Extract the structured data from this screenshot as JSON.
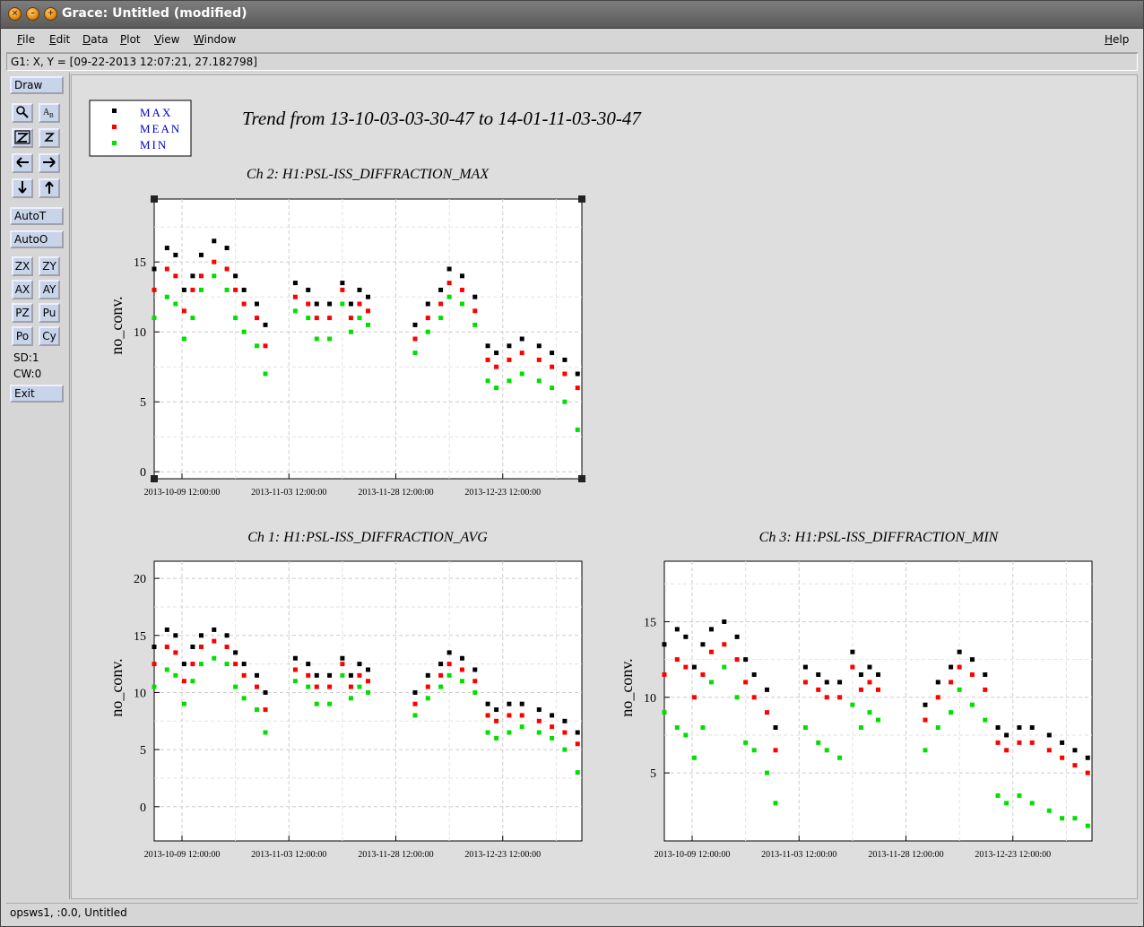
{
  "window": {
    "title": "Grace: Untitled (modified)"
  },
  "menubar": {
    "items": [
      "File",
      "Edit",
      "Data",
      "Plot",
      "View",
      "Window"
    ],
    "accel": [
      "F",
      "E",
      "D",
      "P",
      "V",
      "W"
    ],
    "help": "Help",
    "help_accel": "H"
  },
  "coordbar": {
    "text": "G1: X, Y = [09-22-2013 12:07:21, 27.182798]"
  },
  "toolbar": {
    "draw": "Draw",
    "autot": "AutoT",
    "autoo": "AutoO",
    "pairs": [
      [
        "ZX",
        "ZY"
      ],
      [
        "AX",
        "AY"
      ],
      [
        "PZ",
        "Pu"
      ],
      [
        "Po",
        "Cy"
      ]
    ],
    "sd": "SD:1",
    "cw": "CW:0",
    "exit": "Exit",
    "icons": [
      "zoom-icon",
      "autoscale-icon",
      "zoom-in-icon",
      "zoom-out-icon",
      "arrow-left-icon",
      "arrow-right-icon",
      "arrow-down-icon",
      "arrow-up-icon"
    ]
  },
  "statusbar": {
    "text": "opsws1, :0.0, Untitled"
  },
  "figure": {
    "title": "Trend from 13-10-03-03-30-47 to 14-01-11-03-30-47",
    "legend": [
      {
        "label": "MAX",
        "color": "#000000"
      },
      {
        "label": "MEAN",
        "color": "#ff0000"
      },
      {
        "label": "MIN",
        "color": "#00e000"
      }
    ]
  },
  "chart_data": [
    {
      "type": "scatter",
      "title": "Ch 2: H1:PSL-ISS_DIFFRACTION_MAX",
      "ylabel": "no_conv.",
      "ylim": [
        -0.5,
        19.5
      ],
      "yticks": [
        0,
        5,
        10,
        15
      ],
      "xlim": [
        "2013-10-03",
        "2014-01-11"
      ],
      "xticks": [
        "2013-10-09 12:00:00",
        "2013-11-03 12:00:00",
        "2013-11-28 12:00:00",
        "2013-12-23 12:00:00"
      ],
      "series": [
        {
          "name": "MAX",
          "color": "#000000",
          "x": [
            "2013-10-03",
            "2013-10-06",
            "2013-10-08",
            "2013-10-10",
            "2013-10-12",
            "2013-10-14",
            "2013-10-17",
            "2013-10-20",
            "2013-10-22",
            "2013-10-24",
            "2013-10-27",
            "2013-10-29",
            "2013-11-05",
            "2013-11-08",
            "2013-11-10",
            "2013-11-13",
            "2013-11-16",
            "2013-11-18",
            "2013-11-20",
            "2013-11-22",
            "2013-12-03",
            "2013-12-06",
            "2013-12-09",
            "2013-12-11",
            "2013-12-14",
            "2013-12-17",
            "2013-12-20",
            "2013-12-22",
            "2013-12-25",
            "2013-12-28",
            "2014-01-01",
            "2014-01-04",
            "2014-01-07",
            "2014-01-10"
          ],
          "y": [
            14.5,
            16,
            15.5,
            13,
            14,
            15.5,
            16.5,
            16,
            14,
            13,
            12,
            10.5,
            13.5,
            13,
            12,
            12,
            13.5,
            12,
            13,
            12.5,
            10.5,
            12,
            13,
            14.5,
            14,
            12.5,
            9,
            8.5,
            9,
            9.5,
            9,
            8.5,
            8,
            7
          ]
        },
        {
          "name": "MEAN",
          "color": "#ff0000",
          "x": [
            "2013-10-03",
            "2013-10-06",
            "2013-10-08",
            "2013-10-10",
            "2013-10-12",
            "2013-10-14",
            "2013-10-17",
            "2013-10-20",
            "2013-10-22",
            "2013-10-24",
            "2013-10-27",
            "2013-10-29",
            "2013-11-05",
            "2013-11-08",
            "2013-11-10",
            "2013-11-13",
            "2013-11-16",
            "2013-11-18",
            "2013-11-20",
            "2013-11-22",
            "2013-12-03",
            "2013-12-06",
            "2013-12-09",
            "2013-12-11",
            "2013-12-14",
            "2013-12-17",
            "2013-12-20",
            "2013-12-22",
            "2013-12-25",
            "2013-12-28",
            "2014-01-01",
            "2014-01-04",
            "2014-01-07",
            "2014-01-10"
          ],
          "y": [
            13,
            14.5,
            14,
            11.5,
            13,
            14,
            15,
            14.5,
            13,
            12,
            11,
            9,
            12.5,
            12,
            11,
            11,
            13,
            11,
            12,
            11.5,
            9.5,
            11,
            12,
            13.5,
            13,
            11.5,
            8,
            7.5,
            8,
            8.5,
            8,
            7.5,
            7,
            6
          ]
        },
        {
          "name": "MIN",
          "color": "#00e000",
          "x": [
            "2013-10-03",
            "2013-10-06",
            "2013-10-08",
            "2013-10-10",
            "2013-10-12",
            "2013-10-14",
            "2013-10-17",
            "2013-10-20",
            "2013-10-22",
            "2013-10-24",
            "2013-10-27",
            "2013-10-29",
            "2013-11-05",
            "2013-11-08",
            "2013-11-10",
            "2013-11-13",
            "2013-11-16",
            "2013-11-18",
            "2013-11-20",
            "2013-11-22",
            "2013-12-03",
            "2013-12-06",
            "2013-12-09",
            "2013-12-11",
            "2013-12-14",
            "2013-12-17",
            "2013-12-20",
            "2013-12-22",
            "2013-12-25",
            "2013-12-28",
            "2014-01-01",
            "2014-01-04",
            "2014-01-07",
            "2014-01-10"
          ],
          "y": [
            11,
            12.5,
            12,
            9.5,
            11,
            13,
            14,
            13,
            11,
            10,
            9,
            7,
            11.5,
            11,
            9.5,
            9.5,
            12,
            10,
            11,
            10.5,
            8.5,
            10,
            11,
            12.5,
            12,
            10.5,
            6.5,
            6,
            6.5,
            7,
            6.5,
            6,
            5,
            3
          ]
        }
      ]
    },
    {
      "type": "scatter",
      "title": "Ch 1: H1:PSL-ISS_DIFFRACTION_AVG",
      "ylabel": "no_conv.",
      "ylim": [
        -3,
        21.5
      ],
      "yticks": [
        0,
        5,
        10,
        15,
        20
      ],
      "xlim": [
        "2013-10-03",
        "2014-01-11"
      ],
      "xticks": [
        "2013-10-09 12:00:00",
        "2013-11-03 12:00:00",
        "2013-11-28 12:00:00",
        "2013-12-23 12:00:00"
      ],
      "series": [
        {
          "name": "MAX",
          "color": "#000000",
          "x": [
            "2013-10-03",
            "2013-10-06",
            "2013-10-08",
            "2013-10-10",
            "2013-10-12",
            "2013-10-14",
            "2013-10-17",
            "2013-10-20",
            "2013-10-22",
            "2013-10-24",
            "2013-10-27",
            "2013-10-29",
            "2013-11-05",
            "2013-11-08",
            "2013-11-10",
            "2013-11-13",
            "2013-11-16",
            "2013-11-18",
            "2013-11-20",
            "2013-11-22",
            "2013-12-03",
            "2013-12-06",
            "2013-12-09",
            "2013-12-11",
            "2013-12-14",
            "2013-12-17",
            "2013-12-20",
            "2013-12-22",
            "2013-12-25",
            "2013-12-28",
            "2014-01-01",
            "2014-01-04",
            "2014-01-07",
            "2014-01-10"
          ],
          "y": [
            14,
            15.5,
            15,
            12.5,
            14,
            15,
            15.5,
            15,
            13.5,
            12.5,
            11.5,
            10,
            13,
            12.5,
            11.5,
            11.5,
            13,
            11.5,
            12.5,
            12,
            10,
            11.5,
            12.5,
            13.5,
            13,
            12,
            9,
            8.5,
            9,
            9,
            8.5,
            8,
            7.5,
            6.5
          ]
        },
        {
          "name": "MEAN",
          "color": "#ff0000",
          "x": [
            "2013-10-03",
            "2013-10-06",
            "2013-10-08",
            "2013-10-10",
            "2013-10-12",
            "2013-10-14",
            "2013-10-17",
            "2013-10-20",
            "2013-10-22",
            "2013-10-24",
            "2013-10-27",
            "2013-10-29",
            "2013-11-05",
            "2013-11-08",
            "2013-11-10",
            "2013-11-13",
            "2013-11-16",
            "2013-11-18",
            "2013-11-20",
            "2013-11-22",
            "2013-12-03",
            "2013-12-06",
            "2013-12-09",
            "2013-12-11",
            "2013-12-14",
            "2013-12-17",
            "2013-12-20",
            "2013-12-22",
            "2013-12-25",
            "2013-12-28",
            "2014-01-01",
            "2014-01-04",
            "2014-01-07",
            "2014-01-10"
          ],
          "y": [
            12.5,
            14,
            13.5,
            11,
            12.5,
            14,
            14.5,
            14,
            12.5,
            11.5,
            10.5,
            8.5,
            12,
            11.5,
            10.5,
            10.5,
            12.5,
            10.5,
            11.5,
            11,
            9,
            10.5,
            11.5,
            12.5,
            12,
            11,
            8,
            7.5,
            8,
            8,
            7.5,
            7,
            6.5,
            5.5
          ]
        },
        {
          "name": "MIN",
          "color": "#00e000",
          "x": [
            "2013-10-03",
            "2013-10-06",
            "2013-10-08",
            "2013-10-10",
            "2013-10-12",
            "2013-10-14",
            "2013-10-17",
            "2013-10-20",
            "2013-10-22",
            "2013-10-24",
            "2013-10-27",
            "2013-10-29",
            "2013-11-05",
            "2013-11-08",
            "2013-11-10",
            "2013-11-13",
            "2013-11-16",
            "2013-11-18",
            "2013-11-20",
            "2013-11-22",
            "2013-12-03",
            "2013-12-06",
            "2013-12-09",
            "2013-12-11",
            "2013-12-14",
            "2013-12-17",
            "2013-12-20",
            "2013-12-22",
            "2013-12-25",
            "2013-12-28",
            "2014-01-01",
            "2014-01-04",
            "2014-01-07",
            "2014-01-10"
          ],
          "y": [
            10.5,
            12,
            11.5,
            9,
            11,
            12.5,
            13,
            12.5,
            10.5,
            9.5,
            8.5,
            6.5,
            11,
            10.5,
            9,
            9,
            11.5,
            9.5,
            10.5,
            10,
            8,
            9.5,
            10.5,
            11.5,
            11,
            10,
            6.5,
            6,
            6.5,
            7,
            6.5,
            6,
            5,
            3
          ]
        }
      ]
    },
    {
      "type": "scatter",
      "title": "Ch 3: H1:PSL-ISS_DIFFRACTION_MIN",
      "ylabel": "no_conv.",
      "ylim": [
        0.5,
        19
      ],
      "yticks": [
        5,
        10,
        15
      ],
      "xlim": [
        "2013-10-03",
        "2014-01-11"
      ],
      "xticks": [
        "2013-10-09 12:00:00",
        "2013-11-03 12:00:00",
        "2013-11-28 12:00:00",
        "2013-12-23 12:00:00"
      ],
      "series": [
        {
          "name": "MAX",
          "color": "#000000",
          "x": [
            "2013-10-03",
            "2013-10-06",
            "2013-10-08",
            "2013-10-10",
            "2013-10-12",
            "2013-10-14",
            "2013-10-17",
            "2013-10-20",
            "2013-10-22",
            "2013-10-24",
            "2013-10-27",
            "2013-10-29",
            "2013-11-05",
            "2013-11-08",
            "2013-11-10",
            "2013-11-13",
            "2013-11-16",
            "2013-11-18",
            "2013-11-20",
            "2013-11-22",
            "2013-12-03",
            "2013-12-06",
            "2013-12-09",
            "2013-12-11",
            "2013-12-14",
            "2013-12-17",
            "2013-12-20",
            "2013-12-22",
            "2013-12-25",
            "2013-12-28",
            "2014-01-01",
            "2014-01-04",
            "2014-01-07",
            "2014-01-10"
          ],
          "y": [
            13.5,
            14.5,
            14,
            12,
            13.5,
            14.5,
            15,
            14,
            12.5,
            11.5,
            10.5,
            8,
            12,
            11.5,
            11,
            11,
            13,
            11.5,
            12,
            11.5,
            9.5,
            11,
            12,
            13,
            12.5,
            11.5,
            8,
            7.5,
            8,
            8,
            7.5,
            7,
            6.5,
            6
          ]
        },
        {
          "name": "MEAN",
          "color": "#ff0000",
          "x": [
            "2013-10-03",
            "2013-10-06",
            "2013-10-08",
            "2013-10-10",
            "2013-10-12",
            "2013-10-14",
            "2013-10-17",
            "2013-10-20",
            "2013-10-22",
            "2013-10-24",
            "2013-10-27",
            "2013-10-29",
            "2013-11-05",
            "2013-11-08",
            "2013-11-10",
            "2013-11-13",
            "2013-11-16",
            "2013-11-18",
            "2013-11-20",
            "2013-11-22",
            "2013-12-03",
            "2013-12-06",
            "2013-12-09",
            "2013-12-11",
            "2013-12-14",
            "2013-12-17",
            "2013-12-20",
            "2013-12-22",
            "2013-12-25",
            "2013-12-28",
            "2014-01-01",
            "2014-01-04",
            "2014-01-07",
            "2014-01-10"
          ],
          "y": [
            11.5,
            12.5,
            12,
            10,
            11.5,
            13,
            13.5,
            12.5,
            11,
            10,
            9,
            6.5,
            11,
            10.5,
            10,
            10,
            12,
            10.5,
            11,
            10.5,
            8.5,
            10,
            11,
            12,
            11.5,
            10.5,
            7,
            6.5,
            7,
            7,
            6.5,
            6,
            5.5,
            5
          ]
        },
        {
          "name": "MIN",
          "color": "#00e000",
          "x": [
            "2013-10-03",
            "2013-10-06",
            "2013-10-08",
            "2013-10-10",
            "2013-10-12",
            "2013-10-14",
            "2013-10-17",
            "2013-10-20",
            "2013-10-22",
            "2013-10-24",
            "2013-10-27",
            "2013-10-29",
            "2013-11-05",
            "2013-11-08",
            "2013-11-10",
            "2013-11-13",
            "2013-11-16",
            "2013-11-18",
            "2013-11-20",
            "2013-11-22",
            "2013-12-03",
            "2013-12-06",
            "2013-12-09",
            "2013-12-11",
            "2013-12-14",
            "2013-12-17",
            "2013-12-20",
            "2013-12-22",
            "2013-12-25",
            "2013-12-28",
            "2014-01-01",
            "2014-01-04",
            "2014-01-07",
            "2014-01-10"
          ],
          "y": [
            9,
            8,
            7.5,
            6,
            8,
            11,
            12,
            10,
            7,
            6.5,
            5,
            3,
            8,
            7,
            6.5,
            6,
            9.5,
            8,
            9,
            8.5,
            6.5,
            8,
            9,
            10.5,
            9.5,
            8.5,
            3.5,
            3,
            3.5,
            3,
            2.5,
            2,
            2,
            1.5
          ]
        }
      ]
    }
  ]
}
